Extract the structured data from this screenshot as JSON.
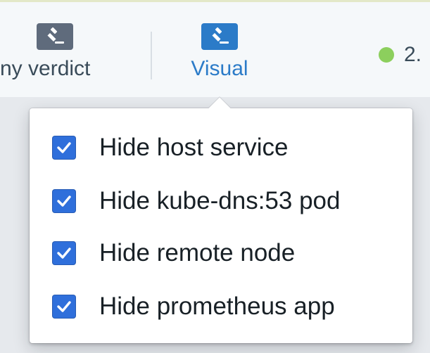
{
  "toolbar": {
    "verdict_label": "ny verdict",
    "visual_label": "Visual",
    "status_text": "2."
  },
  "icons": {
    "verdict": "gavel-icon",
    "visual": "gavel-icon",
    "status": "status-dot-icon",
    "check": "checkmark-icon"
  },
  "colors": {
    "accent": "#2b7bc8",
    "checkbox": "#2f6fdb",
    "status_ok": "#8ccf5d"
  },
  "popover": {
    "options": [
      {
        "label": "Hide host service",
        "checked": true
      },
      {
        "label": "Hide kube-dns:53 pod",
        "checked": true
      },
      {
        "label": "Hide remote node",
        "checked": true
      },
      {
        "label": "Hide prometheus app",
        "checked": true
      }
    ]
  }
}
